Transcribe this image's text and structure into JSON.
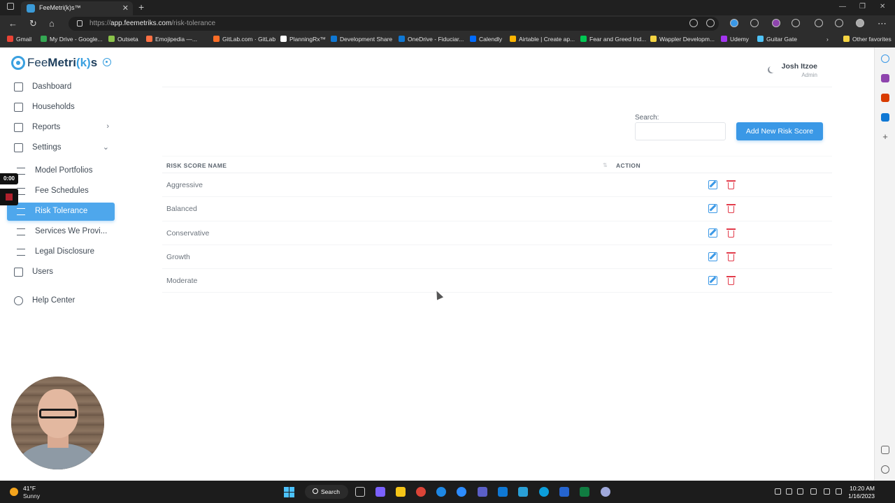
{
  "browser": {
    "tab_title": "FeeMetri(k)s™",
    "url_scheme": "https://",
    "url_host": "app.feemetriks.com",
    "url_path": "/risk-tolerance",
    "bookmarks": [
      {
        "label": "Gmail",
        "color": "#ea4335"
      },
      {
        "label": "My Drive - Google...",
        "color": "#34a853"
      },
      {
        "label": "Outseta",
        "color": "#8bc34a"
      },
      {
        "label": "Emojipedia —...",
        "color": "#ff7043"
      },
      {
        "label": "GitLab.com · GitLab",
        "color": "#fc6d26"
      },
      {
        "label": "PlanningRx™",
        "color": "#ffffff"
      },
      {
        "label": "Development Share",
        "color": "#0f78d4"
      },
      {
        "label": "OneDrive - Fiduciar...",
        "color": "#0f78d4"
      },
      {
        "label": "Calendly",
        "color": "#006bff"
      },
      {
        "label": "Airtable | Create ap...",
        "color": "#fcb400"
      },
      {
        "label": "Fear and Greed Ind...",
        "color": "#00c853"
      },
      {
        "label": "Wappler Developm...",
        "color": "#f5d442"
      },
      {
        "label": "Udemy",
        "color": "#a435f0"
      },
      {
        "label": "Guitar Gate",
        "color": "#4fc3f7"
      },
      {
        "label": "Other favorites",
        "color": "#f5d442"
      }
    ]
  },
  "app": {
    "logo": {
      "prefix": "Fee",
      "bold": "Metri",
      "k": "(k)",
      "suffix": "s"
    },
    "nav": [
      {
        "label": "Dashboard",
        "icon": "bar-chart-icon"
      },
      {
        "label": "Households",
        "icon": "building-icon"
      },
      {
        "label": "Reports",
        "icon": "document-icon"
      },
      {
        "label": "Settings",
        "icon": "grid-icon"
      }
    ],
    "settings_sub": [
      {
        "label": "Model Portfolios",
        "icon": "sliders-icon"
      },
      {
        "label": "Fee Schedules",
        "icon": "sliders-icon"
      },
      {
        "label": "Risk Tolerance",
        "icon": "sliders-icon"
      },
      {
        "label": "Services We Provi...",
        "icon": "toggle-icon"
      },
      {
        "label": "Legal Disclosure",
        "icon": "file-icon"
      }
    ],
    "nav_bottom": [
      {
        "label": "Users",
        "icon": "users-icon"
      },
      {
        "label": "Help Center",
        "icon": "info-icon"
      }
    ],
    "user": {
      "name": "Josh Itzoe",
      "role": "Admin"
    },
    "search_label": "Search:",
    "add_button": "Add New Risk Score",
    "table": {
      "headers": [
        "RISK SCORE NAME",
        "ACTION"
      ],
      "rows": [
        "Aggressive",
        "Balanced",
        "Conservative",
        "Growth",
        "Moderate"
      ]
    },
    "accent_color": "#3a98e6",
    "delete_color": "#e23b4a"
  },
  "recorder": {
    "timer": "0:00"
  },
  "taskbar": {
    "temperature": "41°F",
    "condition": "Sunny",
    "search_label": "Search",
    "time": "10:20 AM",
    "date": "1/16/2023"
  }
}
